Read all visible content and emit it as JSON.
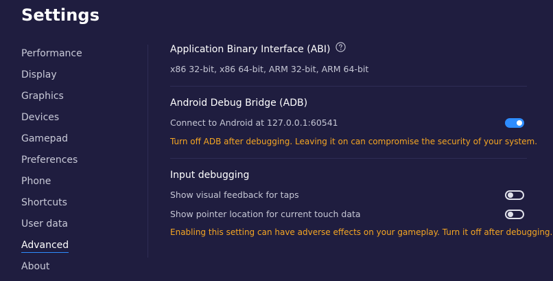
{
  "header": {
    "title": "Settings"
  },
  "sidebar": {
    "items": [
      {
        "label": "Performance"
      },
      {
        "label": "Display"
      },
      {
        "label": "Graphics"
      },
      {
        "label": "Devices"
      },
      {
        "label": "Gamepad"
      },
      {
        "label": "Preferences"
      },
      {
        "label": "Phone"
      },
      {
        "label": "Shortcuts"
      },
      {
        "label": "User data"
      },
      {
        "label": "Advanced"
      },
      {
        "label": "About"
      }
    ],
    "active": "Advanced"
  },
  "abi": {
    "title": "Application Binary Interface (ABI)",
    "help_icon": "question-circle-icon",
    "value": "x86 32-bit, x86 64-bit, ARM 32-bit, ARM 64-bit"
  },
  "adb": {
    "title": "Android Debug Bridge (ADB)",
    "connect_label": "Connect to Android at 127.0.0.1:60541",
    "connect_enabled": true,
    "warning": "Turn off ADB after debugging. Leaving it on can compromise the security of your system."
  },
  "input_debugging": {
    "title": "Input debugging",
    "visual_feedback_label": "Show visual feedback for taps",
    "visual_feedback_enabled": false,
    "pointer_location_label": "Show pointer location for current touch data",
    "pointer_location_enabled": false,
    "warning": "Enabling this setting can have adverse effects on your gameplay. Turn it off after debugging."
  },
  "colors": {
    "background": "#1f1d3f",
    "accent": "#2e8dff",
    "warning": "#f5a623"
  }
}
